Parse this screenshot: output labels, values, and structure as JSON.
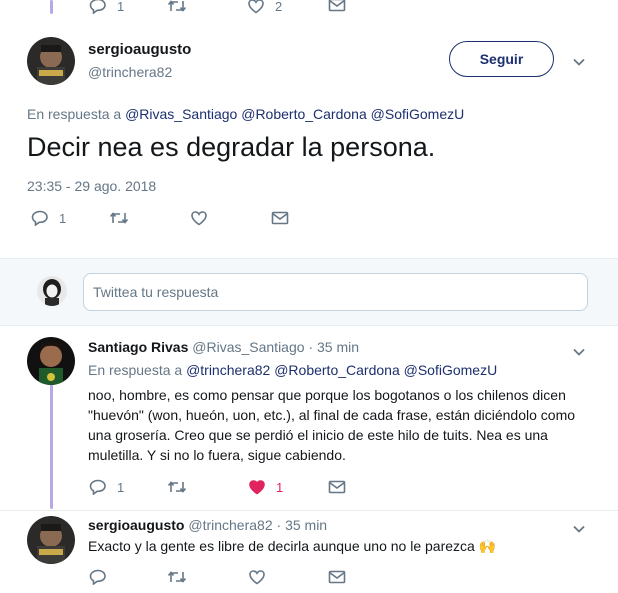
{
  "top_actions": {
    "reply_count": "1",
    "like_count": "2"
  },
  "main_tweet": {
    "author_name": "sergioaugusto",
    "author_handle": "@trinchera82",
    "follow_label": "Seguir",
    "reply_prefix": "En respuesta a",
    "reply_mentions": [
      "@Rivas_Santiago",
      "@Roberto_Cardona",
      "@SofiGomezU"
    ],
    "text": "Decir nea es degradar la persona.",
    "timestamp": "23:35 - 29 ago. 2018",
    "reply_count": "1"
  },
  "compose": {
    "placeholder": "Twittea tu respuesta"
  },
  "replies": [
    {
      "author_name": "Santiago Rivas",
      "author_handle": "@Rivas_Santiago",
      "time": "· 35 min",
      "reply_prefix": "En respuesta a",
      "reply_mentions": [
        "@trinchera82",
        "@Roberto_Cardona",
        "@SofiGomezU"
      ],
      "text": "noo, hombre, es como pensar que porque los bogotanos o los chilenos dicen \"huevón\" (won, huеón, uon, etc.), al final de cada frase, están diciéndolo como una grosería. Creo que se perdió el inicio de este hilo de tuits. Nea es una muletilla. Y si no lo fuera, sigue cabiendo.",
      "reply_count": "1",
      "like_count": "1"
    },
    {
      "author_name": "sergioaugusto",
      "author_handle": "@trinchera82",
      "time": "· 35 min",
      "text": "Exacto y la gente es libre de decirla aunque uno no le parezca 🙌"
    }
  ],
  "colors": {
    "link": "#1c2f6e",
    "muted": "#657786",
    "like_active": "#e0245e",
    "thread_accent": "#b8a9e6"
  }
}
